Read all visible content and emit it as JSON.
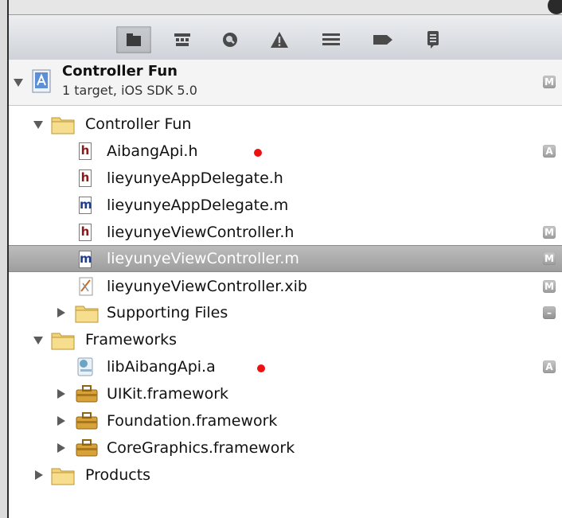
{
  "toolbar": {
    "icons": [
      "folder-icon",
      "hierarchy-icon",
      "search-icon",
      "warning-icon",
      "list-icon",
      "breakpoint-icon",
      "log-icon"
    ]
  },
  "project": {
    "name": "Controller Fun",
    "subtitle": "1 target, iOS SDK 5.0",
    "badge": "M"
  },
  "tree": [
    {
      "label": "Controller Fun",
      "type": "folder",
      "expanded": true,
      "badge": ""
    },
    {
      "label": "AibangApi.h",
      "type": "h",
      "badge": "A",
      "marked": true
    },
    {
      "label": "lieyunyeAppDelegate.h",
      "type": "h",
      "badge": ""
    },
    {
      "label": "lieyunyeAppDelegate.m",
      "type": "m",
      "badge": ""
    },
    {
      "label": "lieyunyeViewController.h",
      "type": "h",
      "badge": "M"
    },
    {
      "label": "lieyunyeViewController.m",
      "type": "m",
      "badge": "M",
      "selected": true
    },
    {
      "label": "lieyunyeViewController.xib",
      "type": "xib",
      "badge": "M"
    },
    {
      "label": "Supporting Files",
      "type": "folder",
      "expanded": false,
      "badge": "–"
    },
    {
      "label": "Frameworks",
      "type": "folder",
      "expanded": true,
      "badge": ""
    },
    {
      "label": "libAibangApi.a",
      "type": "lib",
      "badge": "A",
      "marked": true
    },
    {
      "label": "UIKit.framework",
      "type": "framework",
      "expanded": false,
      "badge": ""
    },
    {
      "label": "Foundation.framework",
      "type": "framework",
      "expanded": false,
      "badge": ""
    },
    {
      "label": "CoreGraphics.framework",
      "type": "framework",
      "expanded": false,
      "badge": ""
    },
    {
      "label": "Products",
      "type": "folder",
      "expanded": false,
      "badge": ""
    }
  ],
  "colors": {
    "marker": "#ee1111",
    "header_file": "#8b1a1a",
    "impl_file": "#1d3d8f",
    "selection": "#a8a8a8",
    "folder": "#f3d27a"
  }
}
